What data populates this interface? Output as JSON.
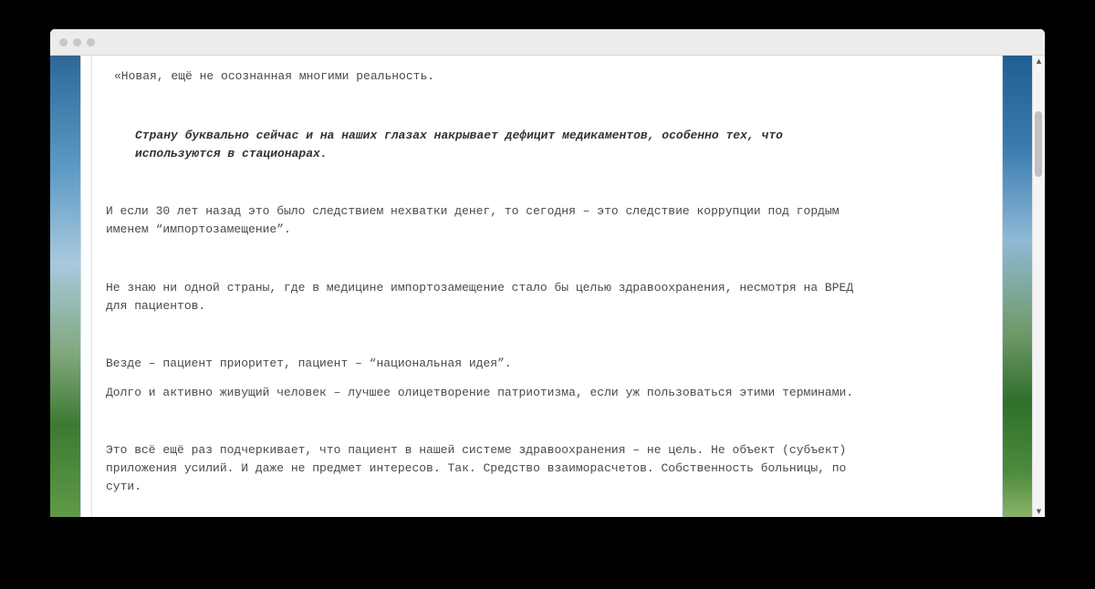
{
  "article": {
    "p1": "«Новая, ещё не осознанная многими реальность.",
    "quote_line1": "Страну буквально сейчас и на наших глазах накрывает дефицит медикаментов, особенно тех, что",
    "quote_line2": "используются в стационарах.",
    "p2_line1": "И если 30 лет назад это было следствием нехватки денег, то сегодня – это следствие коррупции под гордым",
    "p2_line2": "именем “импортозамещение”.",
    "p3_line1": "Не знаю ни одной страны, где в медицине импортозамещение стало бы целью здравоохранения, несмотря на ВРЕД",
    "p3_line2": "для пациентов.",
    "p4": "Везде – пациент приоритет, пациент – “национальная идея”.",
    "p5": "Долго и активно живущий человек – лучшее олицетворение патриотизма, если уж пользоваться этими терминами.",
    "p6_line1": "Это всё ещё раз подчеркивает, что пациент в нашей системе здравоохранения – не цель.   Не объект (субъект)",
    "p6_line2": "приложения усилий. И даже не предмет интересов. Так. Средство взаиморасчетов. Собственность больницы, по",
    "p6_line3": "сути."
  },
  "scrollbar": {
    "up_icon": "▲",
    "down_icon": "▼",
    "position": 0.12
  }
}
